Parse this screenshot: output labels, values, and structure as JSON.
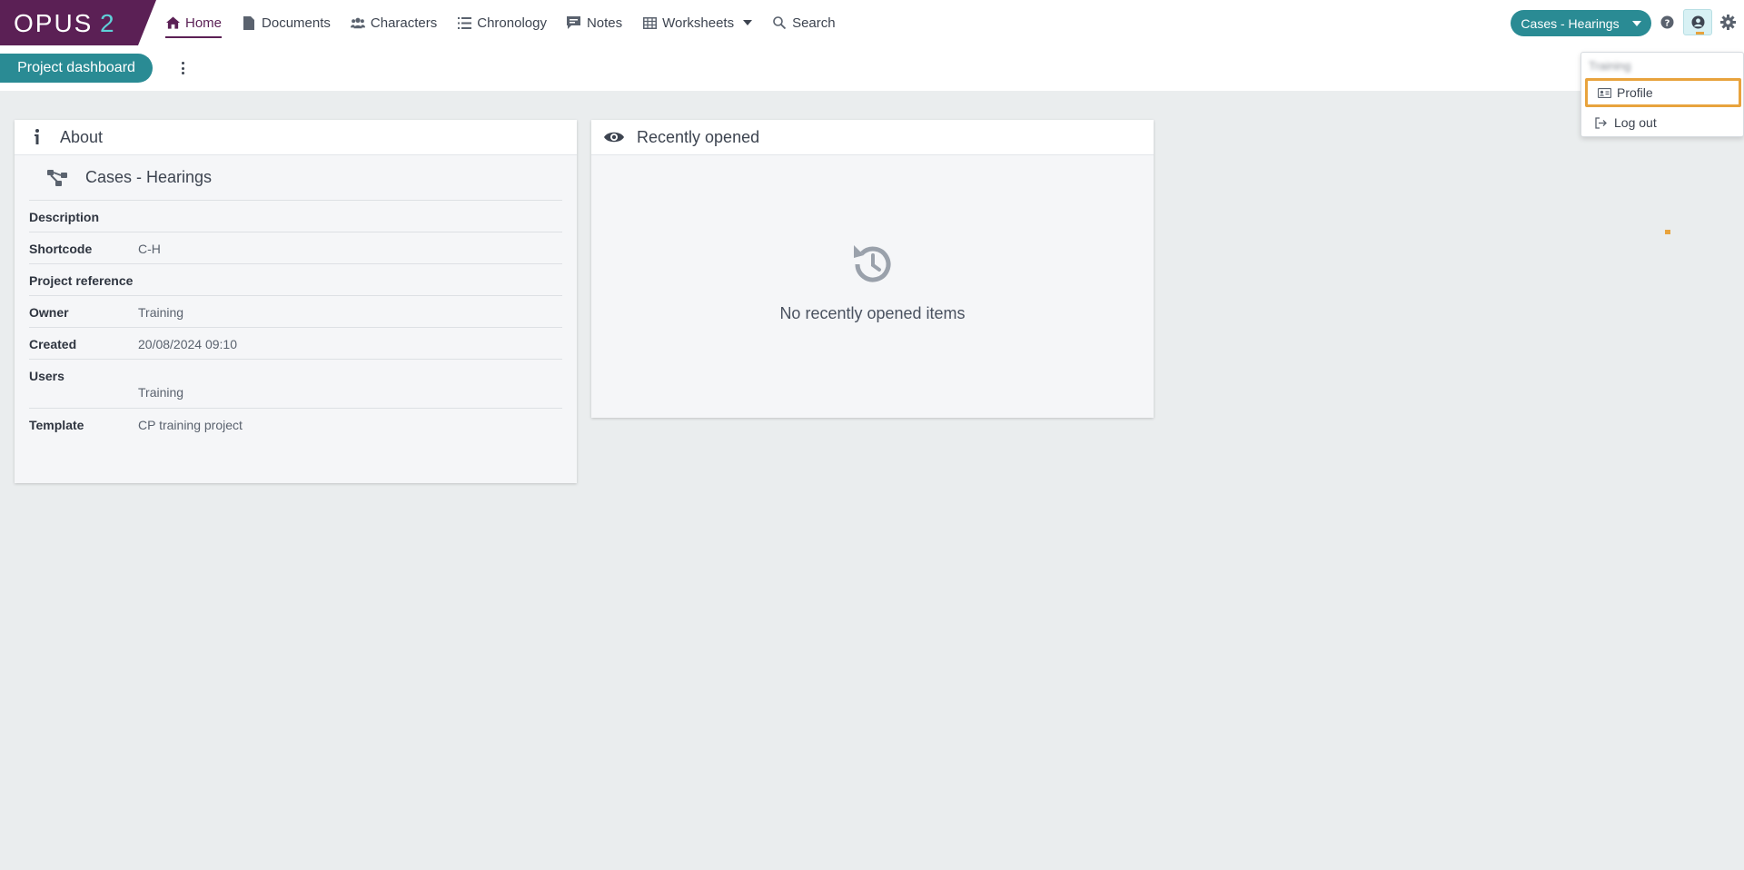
{
  "brand": {
    "logo_text": "OPUS2",
    "logo_bg": "#5b2055",
    "accent": "#2a8b94",
    "highlight": "#e8a33d"
  },
  "nav": {
    "items": [
      {
        "label": "Home",
        "icon": "home-icon"
      },
      {
        "label": "Documents",
        "icon": "document-icon"
      },
      {
        "label": "Characters",
        "icon": "users-icon"
      },
      {
        "label": "Chronology",
        "icon": "list-icon"
      },
      {
        "label": "Notes",
        "icon": "comment-icon"
      },
      {
        "label": "Worksheets",
        "icon": "table-icon"
      },
      {
        "label": "Search",
        "icon": "search-icon"
      }
    ]
  },
  "header": {
    "project_selector": "Cases - Hearings"
  },
  "subbar": {
    "dashboard_label": "Project dashboard"
  },
  "about": {
    "title": "About",
    "project_name": "Cases - Hearings",
    "rows": [
      {
        "key": "Description",
        "value": ""
      },
      {
        "key": "Shortcode",
        "value": "C-H"
      },
      {
        "key": "Project reference",
        "value": ""
      },
      {
        "key": "Owner",
        "value": "Training"
      },
      {
        "key": "Created",
        "value": "20/08/2024 09:10"
      },
      {
        "key": "Users",
        "value": "Training"
      },
      {
        "key": "Template",
        "value": "CP training project"
      }
    ]
  },
  "recent": {
    "title": "Recently opened",
    "empty_message": "No recently opened items"
  },
  "user_menu": {
    "user_name": "Training",
    "items": [
      {
        "label": "Profile",
        "icon": "id-card-icon"
      },
      {
        "label": "Log out",
        "icon": "logout-icon"
      }
    ]
  }
}
